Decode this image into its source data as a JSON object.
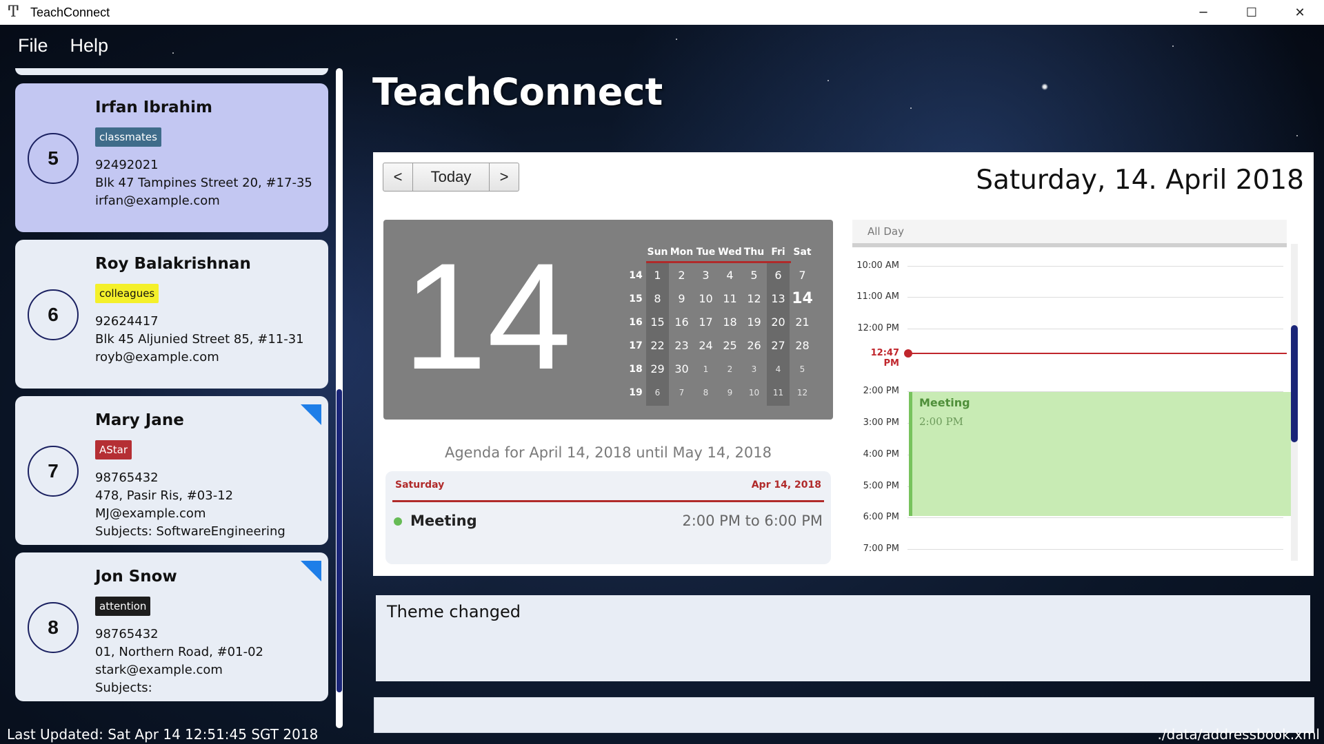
{
  "window": {
    "title": "TeachConnect",
    "app_icon_glyph": "Ͳ",
    "controls": {
      "minimize": "─",
      "maximize": "☐",
      "close": "✕"
    }
  },
  "menu": [
    "File",
    "Help"
  ],
  "header": {
    "app_title": "TeachConnect"
  },
  "persons": [
    {
      "index": "5",
      "name": "Irfan Ibrahim",
      "tag": "classmates",
      "tag_bg": "#3f6c8a",
      "tag_fg": "#ffffff",
      "phone": "92492021",
      "address": "Blk 47 Tampines Street 20, #17-35",
      "email": "irfan@example.com",
      "subjects": "",
      "selected": true,
      "flag": false
    },
    {
      "index": "6",
      "name": "Roy Balakrishnan",
      "tag": "colleagues",
      "tag_bg": "#f4f02a",
      "tag_fg": "#111111",
      "phone": "92624417",
      "address": "Blk 45 Aljunied Street 85, #11-31",
      "email": "royb@example.com",
      "subjects": "",
      "selected": false,
      "flag": false
    },
    {
      "index": "7",
      "name": "Mary Jane",
      "tag": "AStar",
      "tag_bg": "#b52f34",
      "tag_fg": "#ffffff",
      "phone": "98765432",
      "address": "478, Pasir Ris, #03-12",
      "email": "MJ@example.com",
      "subjects": "Subjects: SoftwareEngineering",
      "selected": false,
      "flag": true
    },
    {
      "index": "8",
      "name": "Jon Snow",
      "tag": "attention",
      "tag_bg": "#1d1d1d",
      "tag_fg": "#ffffff",
      "phone": "98765432",
      "address": "01, Northern Road, #01-02",
      "email": "stark@example.com",
      "subjects": "Subjects:",
      "selected": false,
      "flag": true
    }
  ],
  "calendar": {
    "nav": {
      "prev": "<",
      "today": "Today",
      "next": ">"
    },
    "date_header": "Saturday, 14. April 2018",
    "big_day": "14",
    "weekdays": [
      "Sun",
      "Mon",
      "Tue",
      "Wed",
      "Thu",
      "Fri",
      "Sat"
    ],
    "weeks": [
      {
        "wk": "14",
        "days": [
          "1",
          "2",
          "3",
          "4",
          "5",
          "6",
          "7"
        ]
      },
      {
        "wk": "15",
        "days": [
          "8",
          "9",
          "10",
          "11",
          "12",
          "13",
          "14"
        ]
      },
      {
        "wk": "16",
        "days": [
          "15",
          "16",
          "17",
          "18",
          "19",
          "20",
          "21"
        ]
      },
      {
        "wk": "17",
        "days": [
          "22",
          "23",
          "24",
          "25",
          "26",
          "27",
          "28"
        ]
      },
      {
        "wk": "18",
        "days": [
          "29",
          "30",
          "1",
          "2",
          "3",
          "4",
          "5"
        ]
      },
      {
        "wk": "19",
        "days": [
          "6",
          "7",
          "8",
          "9",
          "10",
          "11",
          "12"
        ]
      }
    ],
    "agenda": {
      "title": "Agenda for April 14, 2018 until May 14, 2018",
      "day": "Saturday",
      "date": "Apr 14, 2018",
      "event": "Meeting",
      "time": "2:00 PM to 6:00 PM",
      "event_color": "#66bb55"
    },
    "dayview": {
      "allday_label": "All Day",
      "hours": [
        "10:00 AM",
        "11:00 AM",
        "12:00 PM",
        "2:00 PM",
        "3:00 PM",
        "4:00 PM",
        "5:00 PM",
        "6:00 PM",
        "7:00 PM"
      ],
      "now_label": "12:47 PM",
      "event_title": "Meeting",
      "event_time": "2:00 PM"
    }
  },
  "result": {
    "text": "Theme changed"
  },
  "command": {
    "value": ""
  },
  "status": {
    "last_updated": "Last Updated: Sat Apr 14 12:51:45 SGT 2018",
    "file_path": "./data/addressbook.xml"
  },
  "colors": {
    "accent": "#1a2578",
    "today_red": "#c0262c",
    "selected_card": "#c3c7f2"
  }
}
